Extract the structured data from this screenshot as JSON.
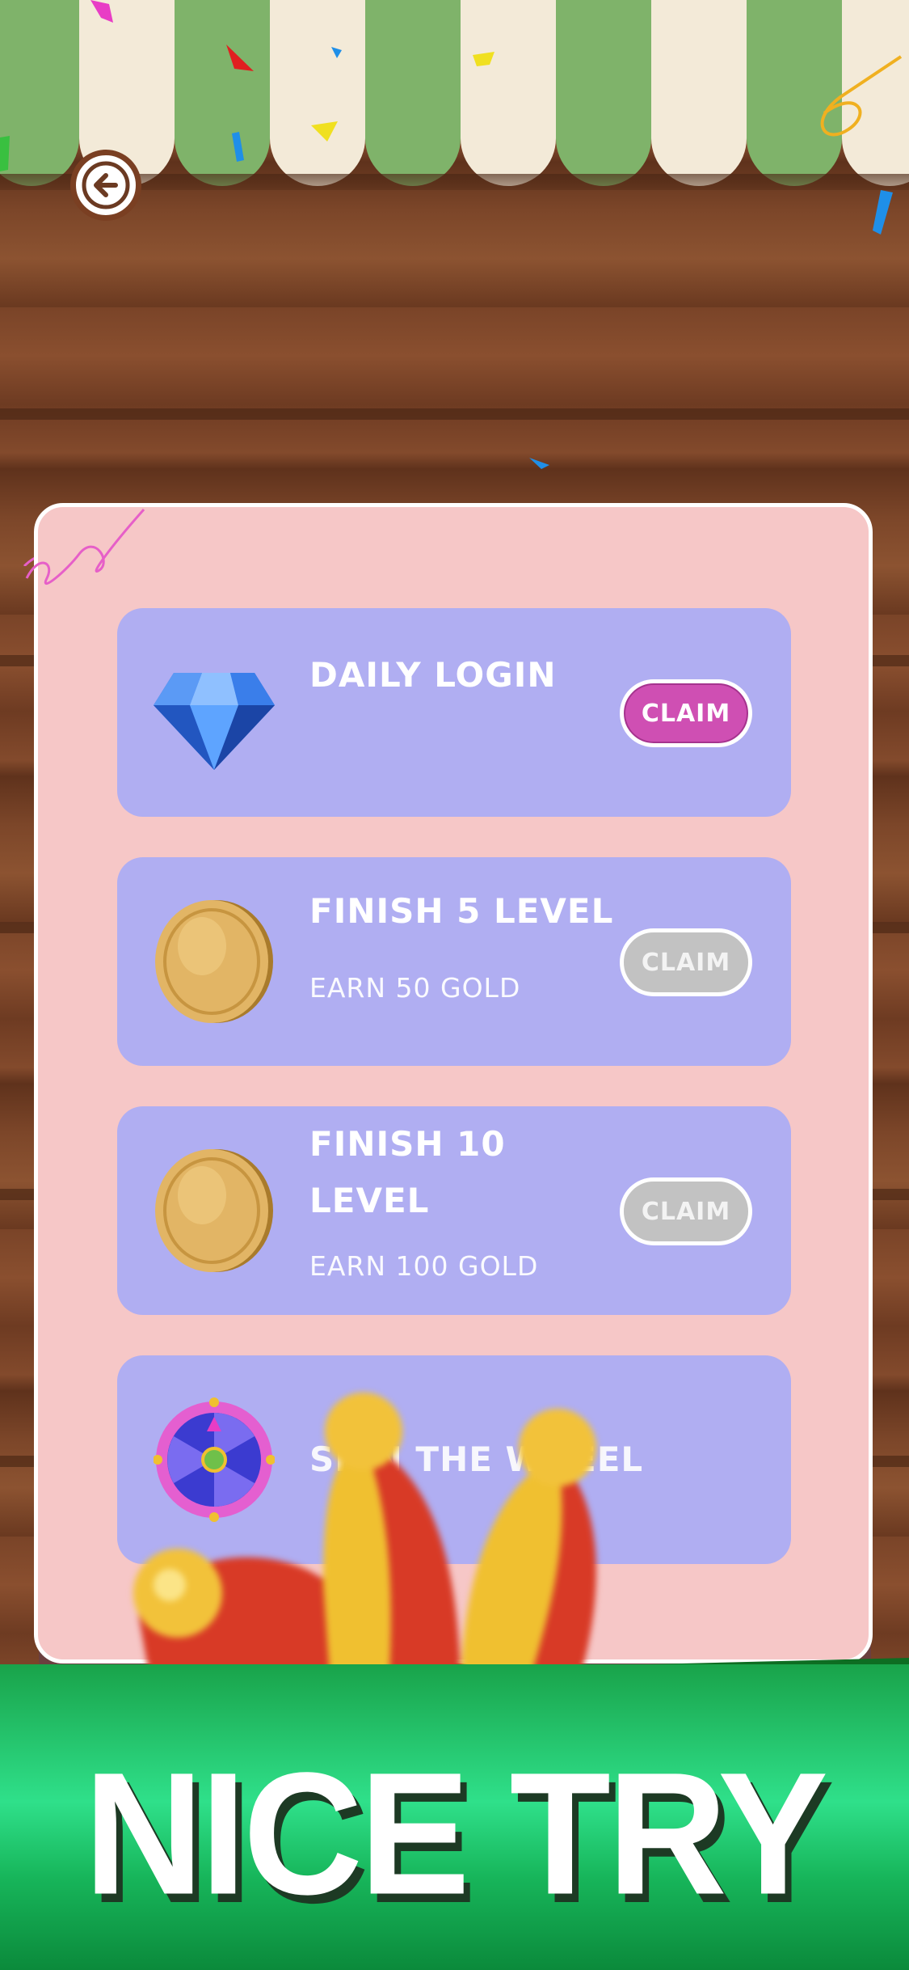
{
  "banner": {
    "text": "NICE TRY"
  },
  "tasks": [
    {
      "icon": "diamond-icon",
      "title": "DAILY LOGIN",
      "subtitle": "",
      "claim_label": "CLAIM",
      "claim_state": "active"
    },
    {
      "icon": "gold-coin-icon",
      "title": "FINISH 5 LEVEL",
      "subtitle": "EARN 50 GOLD",
      "claim_label": "CLAIM",
      "claim_state": "disabled"
    },
    {
      "icon": "gold-coin-icon",
      "title_line1": "FINISH 10",
      "title_line2": "LEVEL",
      "subtitle": "EARN 100 GOLD",
      "claim_label": "CLAIM",
      "claim_state": "disabled"
    },
    {
      "icon": "spin-wheel-icon",
      "title": "SPIN THE WHEEL"
    }
  ],
  "colors": {
    "card": "#b0aef2",
    "panel": "#f6c7c7",
    "claim_active": "#cf4fb3",
    "claim_disabled": "#c2c2c2",
    "banner": "#2fe08a"
  }
}
